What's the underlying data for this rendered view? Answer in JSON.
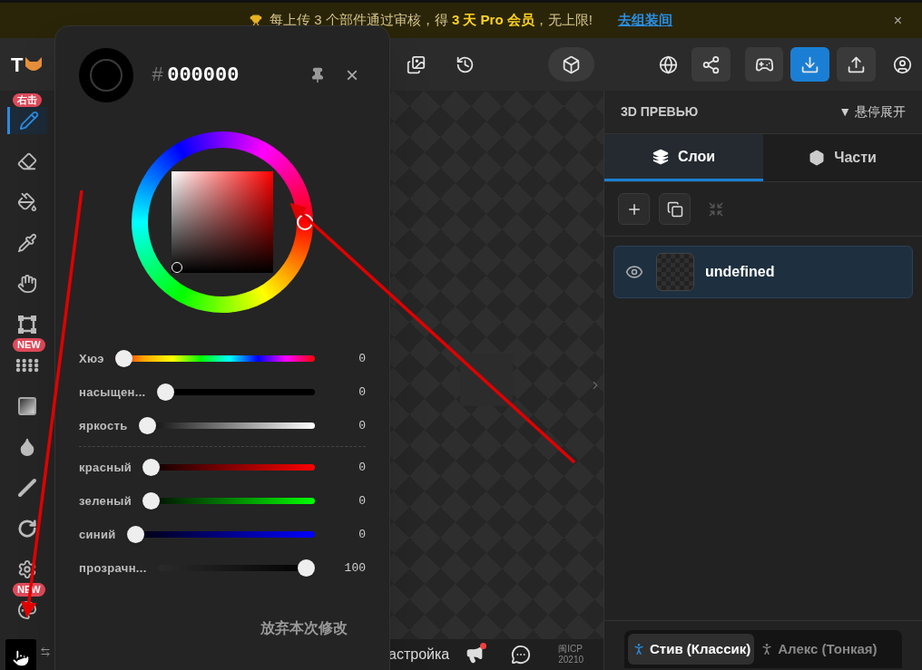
{
  "banner": {
    "message": "每上传 3 个部件通过审核，得 **3 天 Pro 会员**，无上限!",
    "link": "去组装间",
    "close": "×"
  },
  "toolbar": {
    "logo_text": "T",
    "buttons": [
      {
        "kind": "image"
      },
      {
        "kind": "history"
      },
      {
        "kind": "box"
      },
      {
        "kind": "globe"
      },
      {
        "kind": "share"
      },
      {
        "kind": "gamepad"
      },
      {
        "kind": "download"
      },
      {
        "kind": "upload"
      },
      {
        "kind": "user"
      }
    ]
  },
  "tools": [
    {
      "kind": "pen",
      "selected": true,
      "badge": "右击"
    },
    {
      "kind": "eraser",
      "selected": false
    },
    {
      "kind": "bucket",
      "selected": false
    },
    {
      "kind": "eyedropper",
      "selected": false
    },
    {
      "kind": "hand",
      "selected": false
    },
    {
      "kind": "transform",
      "selected": false
    },
    {
      "kind": "dots",
      "selected": false,
      "badge": "NEW"
    },
    {
      "kind": "gradient",
      "selected": false
    },
    {
      "kind": "drop",
      "selected": false
    },
    {
      "kind": "line",
      "selected": false
    },
    {
      "kind": "rotate",
      "selected": false
    },
    {
      "kind": "gear",
      "selected": false
    },
    {
      "kind": "palette",
      "selected": false,
      "badge": "NEW"
    }
  ],
  "color_picker": {
    "hex_prefix": "#",
    "hex": "000000",
    "close": "×",
    "slider_groups": [
      {
        "sliders": [
          {
            "kind": "hue",
            "label": "Хюэ",
            "value": "0",
            "level": 0
          },
          {
            "kind": "saturation",
            "label": "насыщен...",
            "value": "0",
            "level": 0
          },
          {
            "kind": "brightness",
            "label": "яркость",
            "value": "0",
            "level": 0
          }
        ]
      },
      {
        "sliders": [
          {
            "kind": "red",
            "label": "красный",
            "value": "0",
            "level": 0
          },
          {
            "kind": "green",
            "label": "зеленый",
            "value": "0",
            "level": 0
          },
          {
            "kind": "blue",
            "label": "синий",
            "value": "0",
            "level": 0
          },
          {
            "kind": "alpha",
            "label": "прозрачн...",
            "value": "100",
            "level": 1
          }
        ]
      }
    ],
    "discard": "放弃本次修改"
  },
  "canvas_footer": {
    "settings_label": "астройка",
    "unread": true,
    "icp_lines": [
      "闽ICP",
      "20210"
    ]
  },
  "right_panel": {
    "title": "3D ПРЕВЬЮ",
    "hover_toggle": "▼ 悬停展开",
    "tabs": [
      {
        "kind": "layers",
        "label": "Слои",
        "selected": true
      },
      {
        "kind": "parts",
        "label": "Части",
        "selected": false
      }
    ],
    "layer_actions": [
      {
        "kind": "add",
        "disabled": false
      },
      {
        "kind": "duplicate",
        "disabled": false
      },
      {
        "kind": "merge",
        "disabled": true
      }
    ],
    "layers": [
      {
        "name": "undefined",
        "visible": true,
        "selected": true
      }
    ],
    "models": [
      {
        "label": "Стив (Классик)",
        "selected": true
      },
      {
        "label": "Алекс (Тонкая)",
        "selected": false
      }
    ]
  },
  "annotations": [
    {
      "kind": "arrow"
    },
    {
      "kind": "arrow"
    }
  ]
}
